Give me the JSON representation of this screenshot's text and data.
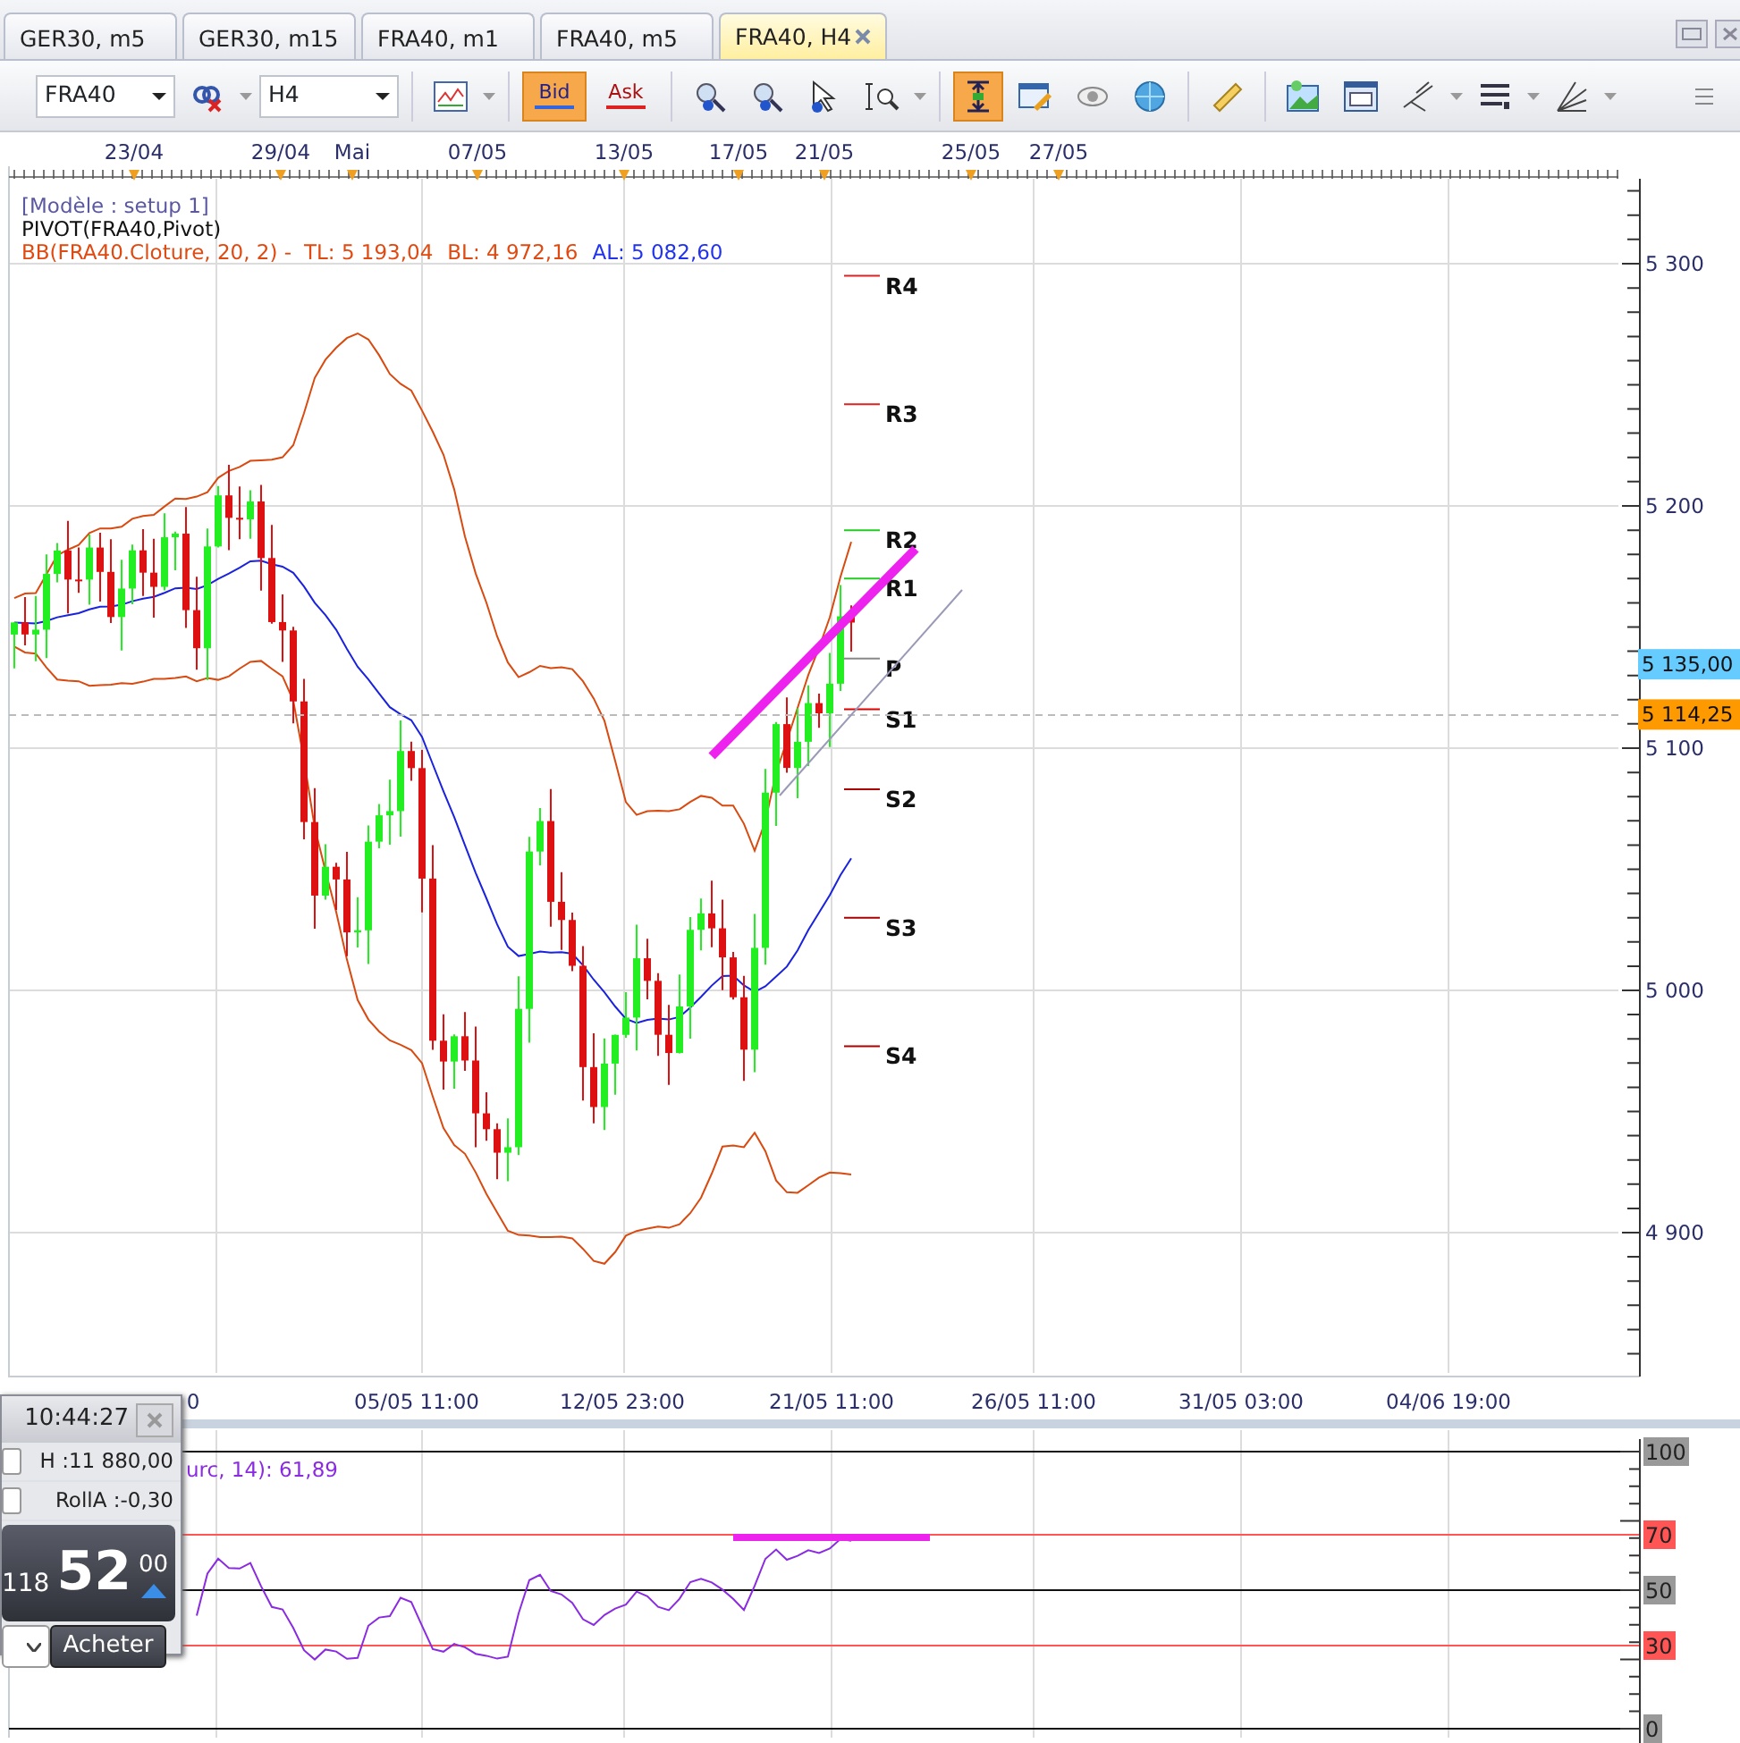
{
  "tabs": [
    {
      "label": "GER30, m5",
      "selected": false
    },
    {
      "label": "GER30, m15",
      "selected": false
    },
    {
      "label": "FRA40, m1",
      "selected": false
    },
    {
      "label": "FRA40, m5",
      "selected": false
    },
    {
      "label": "FRA40, H4",
      "selected": true
    }
  ],
  "toolbar": {
    "symbol": "FRA40",
    "timeframe": "H4",
    "price_modes": [
      {
        "label": "Bid",
        "selected": true
      },
      {
        "label": "Ask",
        "selected": false
      }
    ]
  },
  "top_axis": [
    "23/04",
    "29/04",
    "Mai",
    "07/05",
    "13/05",
    "17/05",
    "21/05",
    "25/05",
    "27/05"
  ],
  "legend": {
    "template": "[Modèle : setup 1]",
    "pivot": "PIVOT(FRA40,Pivot)",
    "bb": "BB(FRA40.Cloture, 20, 2) -",
    "tl": "TL: 5 193,04",
    "bl": "BL: 4 972,16",
    "al": "AL: 5 082,60"
  },
  "price_axis": [
    "5 300",
    "5 200",
    "5 100",
    "5 000",
    "4 900"
  ],
  "price_tags": [
    {
      "text": "5 135,00",
      "color": "#66ccff"
    },
    {
      "text": "5 114,25",
      "color": "#ff9900"
    }
  ],
  "pivots": [
    "R4",
    "R3",
    "R2",
    "R1",
    "P",
    "S1",
    "S2",
    "S3",
    "S4"
  ],
  "time_axis": [
    "0",
    "05/05 11:00",
    "12/05 23:00",
    "21/05 11:00",
    "26/05 11:00",
    "31/05 03:00",
    "04/06 19:00"
  ],
  "rsi": {
    "legend": "urc, 14): 61,89",
    "levels": [
      {
        "text": "100",
        "color": "#999999"
      },
      {
        "text": "70",
        "color": "#ff5555"
      },
      {
        "text": "50",
        "color": "#999999"
      },
      {
        "text": "30",
        "color": "#ff5555"
      },
      {
        "text": "0",
        "color": "#999999"
      }
    ]
  },
  "ticket": {
    "time": "10:44:27",
    "options": [
      {
        "text": "H :11 880,00",
        "checked": false
      },
      {
        "text": "RollA :-0,30",
        "checked": false
      }
    ],
    "price_prefix": "118",
    "price_big": "52",
    "price_small": "00",
    "action": "Acheter"
  }
}
